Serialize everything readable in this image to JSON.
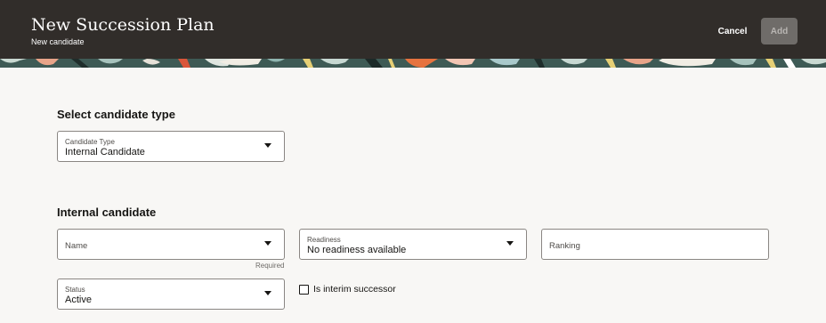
{
  "header": {
    "title": "New Succession Plan",
    "subtitle": "New candidate",
    "cancel_label": "Cancel",
    "add_label": "Add"
  },
  "colors": {
    "header_bg": "#312d2a",
    "page_bg": "#f8f7f5",
    "add_button_bg": "#6f6c69"
  },
  "candidate_type_section": {
    "title": "Select candidate type",
    "candidate_type": {
      "label": "Candidate Type",
      "value": "Internal Candidate"
    }
  },
  "internal_candidate_section": {
    "title": "Internal candidate",
    "name": {
      "placeholder": "Name",
      "helper": "Required"
    },
    "readiness": {
      "label": "Readiness",
      "value": "No readiness available"
    },
    "ranking": {
      "placeholder": "Ranking"
    },
    "status": {
      "label": "Status",
      "value": "Active"
    },
    "interim": {
      "label": "Is interim successor",
      "checked": false
    }
  }
}
